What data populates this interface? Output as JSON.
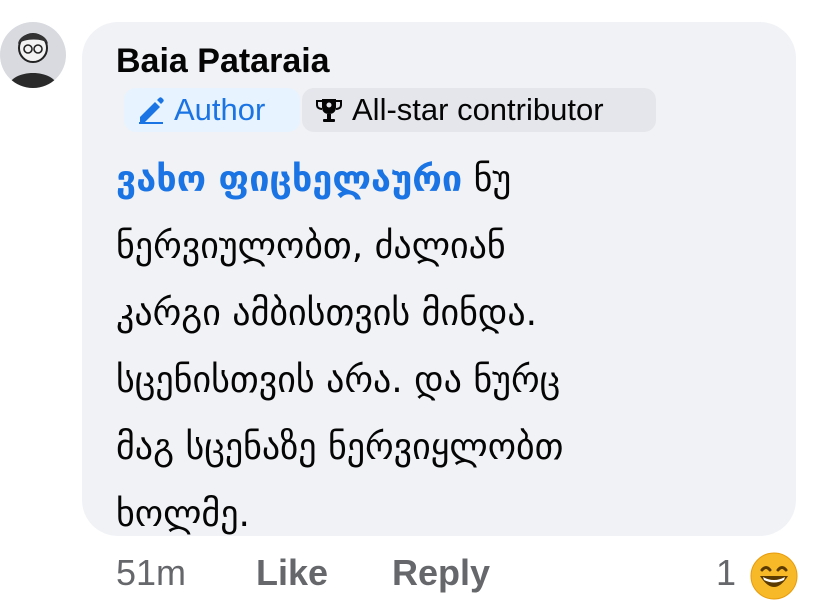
{
  "comment": {
    "author": "Baia Pataraia",
    "badges": [
      {
        "label": "Author",
        "icon": "pencil-icon"
      },
      {
        "label": "All-star contributor",
        "icon": "trophy-icon"
      }
    ],
    "mention": "ვახო ფიცხელაური",
    "text_lines": [
      "ნუ",
      "ნერვიულობთ, ძალიან",
      "კარგი ამბისთვის მინდა.",
      "სცენისთვის არა. და ნურც",
      "მაგ სცენაზე ნერვიყლობთ",
      "ხოლმე."
    ]
  },
  "footer": {
    "time": "51m",
    "like": "Like",
    "reply": "Reply",
    "reaction_count": "1",
    "reaction_icon": "laughing-emoji-icon"
  },
  "colors": {
    "bubble": "#f0f2f5",
    "link": "#1b74e4",
    "author_badge_bg": "#e7f3ff",
    "muted": "#65676b"
  }
}
